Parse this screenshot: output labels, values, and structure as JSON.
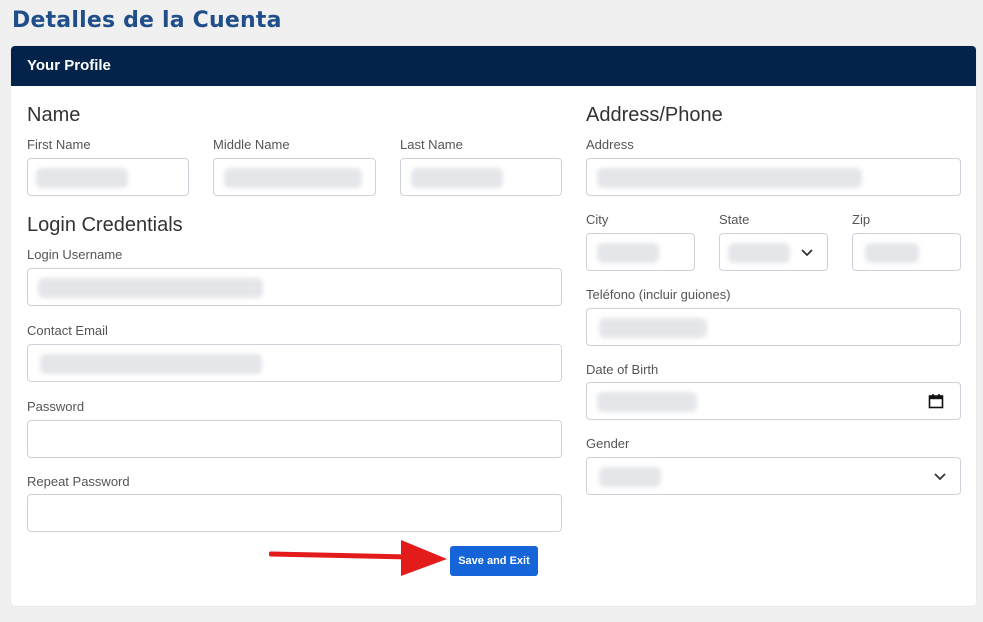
{
  "page_title": "Detalles de la Cuenta",
  "card": {
    "header": "Your Profile"
  },
  "name_section": {
    "title": "Name",
    "first_name_label": "First Name",
    "middle_name_label": "Middle Name",
    "last_name_label": "Last Name"
  },
  "login_section": {
    "title": "Login Credentials",
    "username_label": "Login Username",
    "email_label": "Contact Email",
    "password_label": "Password",
    "repeat_password_label": "Repeat Password"
  },
  "address_section": {
    "title": "Address/Phone",
    "address_label": "Address",
    "city_label": "City",
    "state_label": "State",
    "zip_label": "Zip",
    "phone_label": "Teléfono (incluir guiones)",
    "dob_label": "Date of Birth",
    "gender_label": "Gender"
  },
  "actions": {
    "save_label": "Save and Exit"
  },
  "icons": {
    "select_chevron": "chevron-down-icon",
    "calendar": "calendar-icon",
    "annotation_arrow": "red-arrow"
  },
  "colors": {
    "title": "#1f4e8a",
    "header_bg": "#03234b",
    "button_bg": "#1565d8",
    "arrow": "#e31b1b"
  }
}
